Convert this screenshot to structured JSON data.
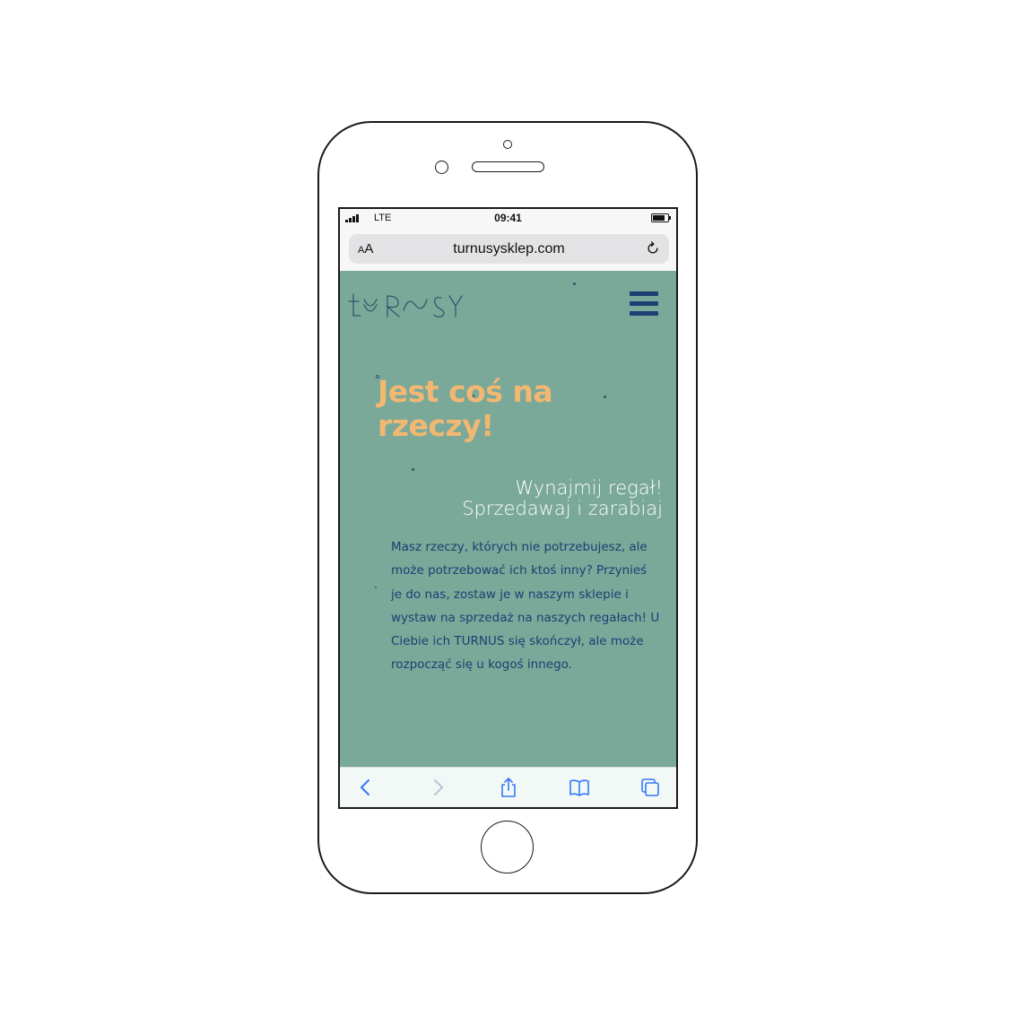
{
  "status_bar": {
    "network": "LTE",
    "time": "09:41"
  },
  "browser": {
    "text_size_small": "A",
    "text_size_large": "A",
    "url": "turnusysklep.com",
    "reload_icon": "reload-icon",
    "toolbar": {
      "back_icon": "chevron-left-icon",
      "forward_icon": "chevron-right-icon",
      "share_icon": "share-icon",
      "bookmarks_icon": "book-icon",
      "tabs_icon": "tabs-icon",
      "accent_color": "#3478f6"
    }
  },
  "site": {
    "logo_text": "TURNUSY",
    "menu_icon": "hamburger-menu-icon",
    "hero": {
      "title": "Jest coś na rzeczy!",
      "subtitle_line1": "Wynajmij regał!",
      "subtitle_line2": "Sprzedawaj i zarabiaj",
      "body": "Masz rzeczy, których nie potrzebujesz, ale może potrzebować ich ktoś inny? Przynieś je do nas, zostaw je w naszym sklepie i wystaw na sprzedaż na naszych regałach!  U Ciebie ich TURNUS się skończył, ale może rozpocząć się u kogoś innego."
    },
    "colors": {
      "background": "#7aa899",
      "title": "#f2b872",
      "body_text": "#1d3f73",
      "subtitle": "#ffffff"
    }
  }
}
